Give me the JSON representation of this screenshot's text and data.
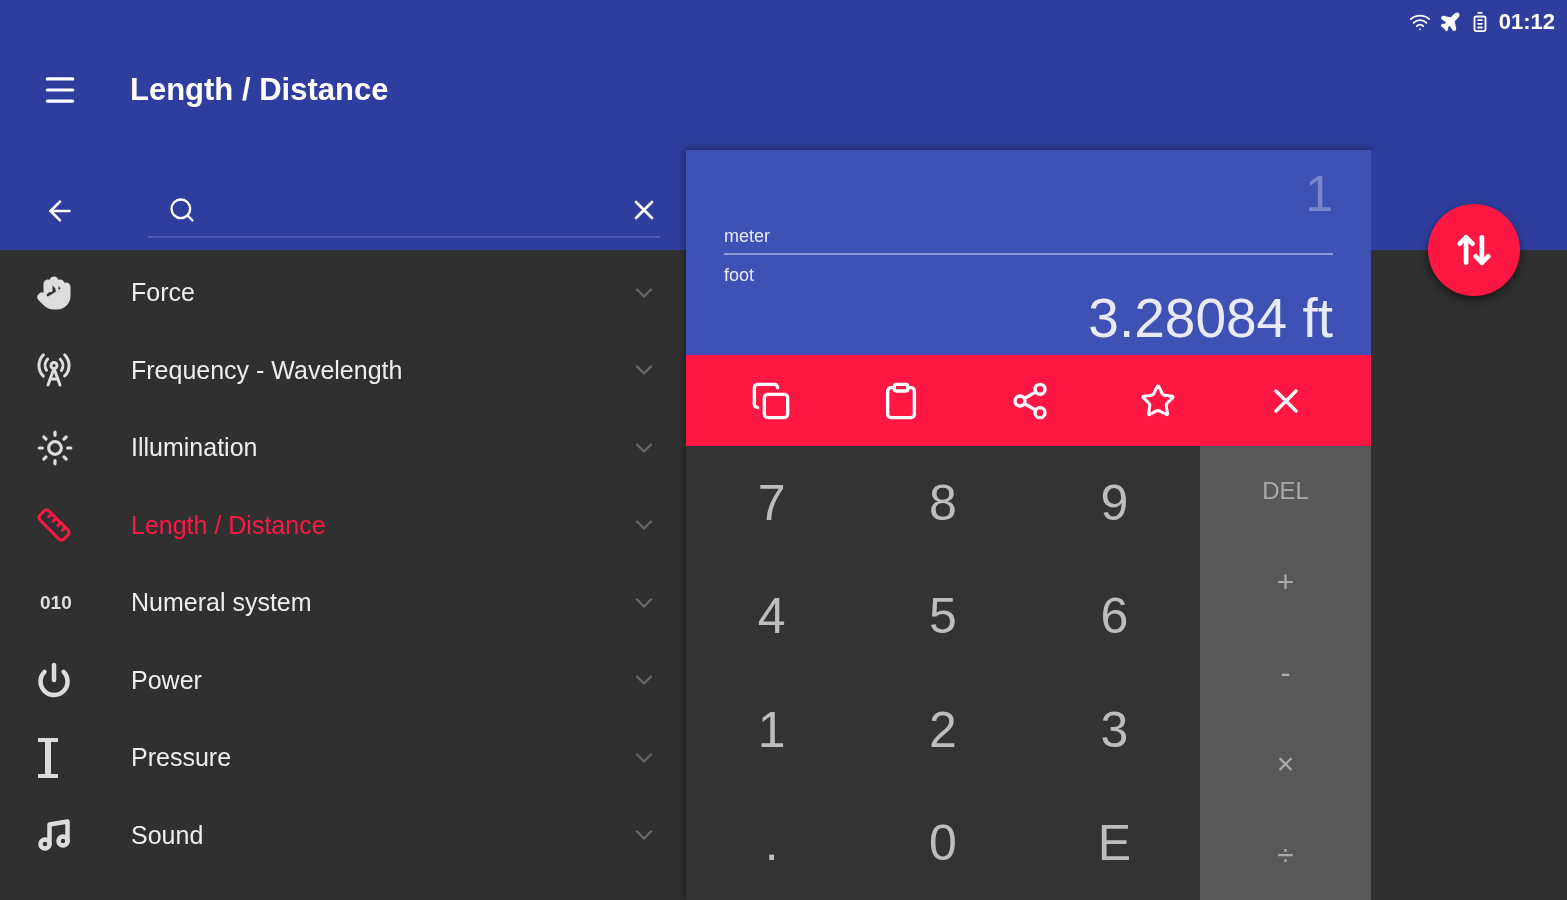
{
  "status_bar": {
    "time": "01:12"
  },
  "toolbar": {
    "title": "Length / Distance"
  },
  "categories": [
    {
      "label": "Force",
      "selected": false,
      "expanded": false
    },
    {
      "label": "Frequency - Wavelength",
      "selected": false,
      "expanded": false
    },
    {
      "label": "Illumination",
      "selected": false,
      "expanded": false
    },
    {
      "label": "Length / Distance",
      "selected": true,
      "expanded": false
    },
    {
      "label": "Numeral system",
      "selected": false,
      "expanded": false,
      "badge": "010"
    },
    {
      "label": "Power",
      "selected": false,
      "expanded": false
    },
    {
      "label": "Pressure",
      "selected": false,
      "expanded": false
    },
    {
      "label": "Sound",
      "selected": false,
      "expanded": false
    }
  ],
  "converter": {
    "from_unit": "meter",
    "from_value": "1",
    "to_unit": "foot",
    "to_value": "3.28084 ft"
  },
  "keypad": {
    "keys": [
      "7",
      "8",
      "9",
      "4",
      "5",
      "6",
      "1",
      "2",
      "3",
      ".",
      "0",
      "E"
    ],
    "operators": [
      "DEL",
      "+",
      "-",
      "×",
      "÷"
    ]
  }
}
